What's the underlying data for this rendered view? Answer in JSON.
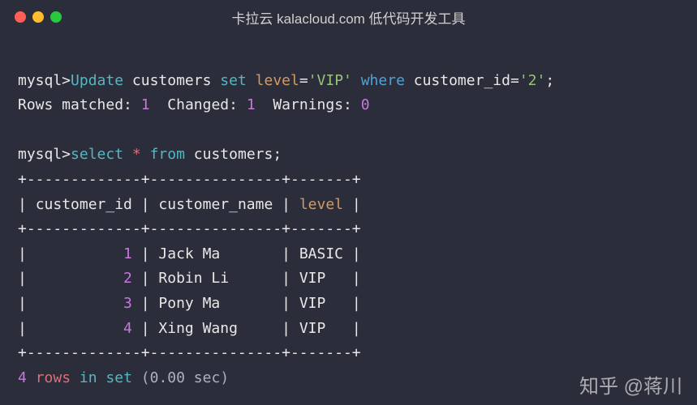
{
  "titlebar": {
    "title": "卡拉云 kalacloud.com 低代码开发工具"
  },
  "prompt": "mysql>",
  "update_stmt": {
    "update_kw": "Update",
    "table": "customers",
    "set_kw": "set",
    "col": "level",
    "eq": "=",
    "val": "'VIP'",
    "where_kw": "where",
    "where_col": "customer_id",
    "where_val": "'2'",
    "semi": ";"
  },
  "update_result": {
    "matched_label": "Rows matched:",
    "matched_val": "1",
    "changed_label": "Changed:",
    "changed_val": "1",
    "warnings_label": "Warnings:",
    "warnings_val": "0"
  },
  "select_stmt": {
    "select_kw": "select",
    "star": "*",
    "from_kw": "from",
    "table": "customers",
    "semi": ";"
  },
  "table": {
    "border_top": "+-------------+---------------+-------+",
    "header": "| customer_id | customer_name | level |",
    "border_mid": "+-------------+---------------+-------+",
    "rows": [
      {
        "id": "1",
        "name": "Jack Ma  ",
        "level": "BASIC"
      },
      {
        "id": "2",
        "name": "Robin Li ",
        "level": "VIP  "
      },
      {
        "id": "3",
        "name": "Pony Ma  ",
        "level": "VIP  "
      },
      {
        "id": "4",
        "name": "Xing Wang",
        "level": "VIP  "
      }
    ],
    "border_bot": "+-------------+---------------+-------+"
  },
  "footer": {
    "count": "4",
    "rows_in_set": "rows in set",
    "time": "(0.00 sec)"
  },
  "watermark": "知乎 @蒋川"
}
